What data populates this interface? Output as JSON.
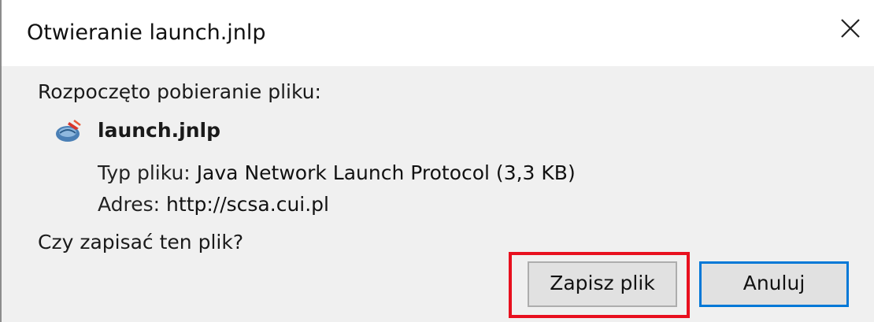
{
  "dialog": {
    "title": "Otwieranie launch.jnlp",
    "close_icon": "close-icon"
  },
  "body": {
    "intro": "Rozpoczęto pobieranie pliku:",
    "file": {
      "icon": "java-webstart-icon",
      "name": "launch.jnlp"
    },
    "type": {
      "label": "Typ pliku:",
      "value": "Java Network Launch Protocol (3,3 KB)"
    },
    "address": {
      "label": "Adres:",
      "value": "http://scsa.cui.pl"
    },
    "question": "Czy zapisać ten plik?"
  },
  "buttons": {
    "save_label": "Zapisz plik",
    "cancel_label": "Anuluj"
  },
  "colors": {
    "highlight": "#e8101e",
    "focus": "#0078d7"
  }
}
